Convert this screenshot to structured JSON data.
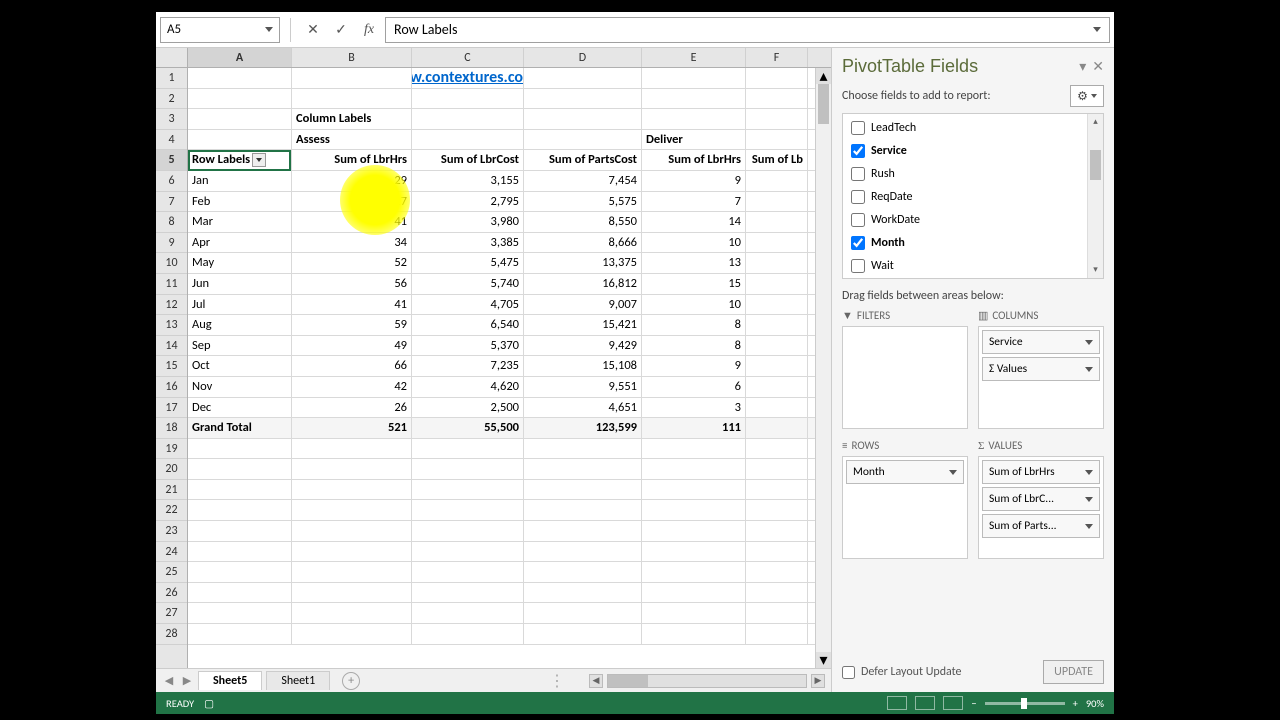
{
  "nameBox": "A5",
  "formulaValue": "Row Labels",
  "columns": [
    "A",
    "B",
    "C",
    "D",
    "E",
    "F"
  ],
  "titleLink": "www.contextures.com",
  "pivot": {
    "colLabelsText": "Column Labels",
    "groups": [
      "Assess",
      "Deliver"
    ],
    "rowLabelsText": "Row Labels",
    "headers": [
      "Sum of LbrHrs",
      "Sum of LbrCost",
      "Sum of PartsCost",
      "Sum of LbrHrs",
      "Sum of Lb"
    ],
    "rows": [
      {
        "r": 6,
        "label": "Jan",
        "v": [
          "29",
          "3,155",
          "7,454",
          "9"
        ]
      },
      {
        "r": 7,
        "label": "Feb",
        "v": [
          "27",
          "2,795",
          "5,575",
          "7"
        ]
      },
      {
        "r": 8,
        "label": "Mar",
        "v": [
          "41",
          "3,980",
          "8,550",
          "14"
        ]
      },
      {
        "r": 9,
        "label": "Apr",
        "v": [
          "34",
          "3,385",
          "8,666",
          "10"
        ]
      },
      {
        "r": 10,
        "label": "May",
        "v": [
          "52",
          "5,475",
          "13,375",
          "13"
        ]
      },
      {
        "r": 11,
        "label": "Jun",
        "v": [
          "56",
          "5,740",
          "16,812",
          "15"
        ]
      },
      {
        "r": 12,
        "label": "Jul",
        "v": [
          "41",
          "4,705",
          "9,007",
          "10"
        ]
      },
      {
        "r": 13,
        "label": "Aug",
        "v": [
          "59",
          "6,540",
          "15,421",
          "8"
        ]
      },
      {
        "r": 14,
        "label": "Sep",
        "v": [
          "49",
          "5,370",
          "9,429",
          "8"
        ]
      },
      {
        "r": 15,
        "label": "Oct",
        "v": [
          "66",
          "7,235",
          "15,108",
          "9"
        ]
      },
      {
        "r": 16,
        "label": "Nov",
        "v": [
          "42",
          "4,620",
          "9,551",
          "6"
        ]
      },
      {
        "r": 17,
        "label": "Dec",
        "v": [
          "26",
          "2,500",
          "4,651",
          "3"
        ]
      }
    ],
    "grandTotal": {
      "label": "Grand Total",
      "v": [
        "521",
        "55,500",
        "123,599",
        "111"
      ]
    }
  },
  "pane": {
    "title": "PivotTable Fields",
    "sub": "Choose fields to add to report:",
    "fields": [
      {
        "name": "LeadTech",
        "checked": false
      },
      {
        "name": "Service",
        "checked": true
      },
      {
        "name": "Rush",
        "checked": false
      },
      {
        "name": "ReqDate",
        "checked": false
      },
      {
        "name": "WorkDate",
        "checked": false
      },
      {
        "name": "Month",
        "checked": true
      },
      {
        "name": "Wait",
        "checked": false
      }
    ],
    "dragLabel": "Drag fields between areas below:",
    "filtersLabel": "FILTERS",
    "columnsLabel": "COLUMNS",
    "rowsLabel": "ROWS",
    "valuesLabel": "VALUES",
    "columnsItems": [
      "Service",
      "Σ Values"
    ],
    "rowsItems": [
      "Month"
    ],
    "valuesItems": [
      "Sum of LbrHrs",
      "Sum of LbrC...",
      "Sum of Parts..."
    ],
    "deferLabel": "Defer Layout Update",
    "updateLabel": "UPDATE"
  },
  "tabs": {
    "active": "Sheet5",
    "other": "Sheet1"
  },
  "status": {
    "ready": "READY",
    "zoom": "90%"
  },
  "emptyRowsStart": 19,
  "emptyRowsEnd": 28
}
